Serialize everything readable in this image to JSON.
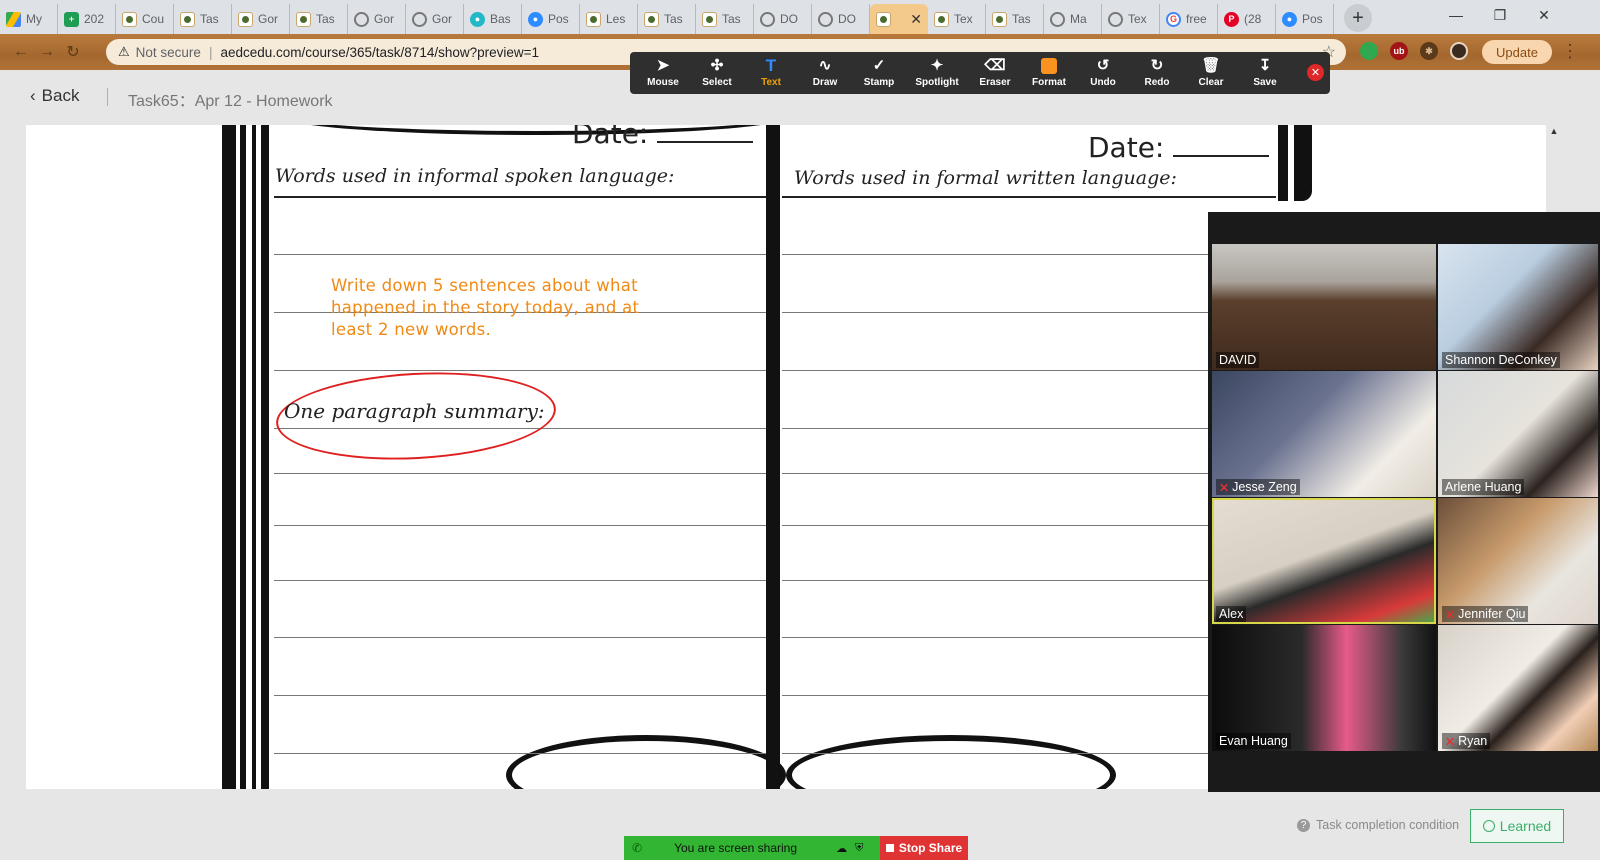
{
  "browser": {
    "tabs": [
      {
        "label": "My",
        "icon": "drive-icon"
      },
      {
        "label": "202",
        "icon": "sheets-icon"
      },
      {
        "label": "Cou",
        "icon": "doc-icon"
      },
      {
        "label": "Tas",
        "icon": "doc-icon"
      },
      {
        "label": "Gor",
        "icon": "doc-icon"
      },
      {
        "label": "Tas",
        "icon": "doc-icon"
      },
      {
        "label": "Gor",
        "icon": "globe-icon"
      },
      {
        "label": "Gor",
        "icon": "globe-icon"
      },
      {
        "label": "Bas",
        "icon": "teal-icon"
      },
      {
        "label": "Pos",
        "icon": "zoom-icon"
      },
      {
        "label": "Les",
        "icon": "doc-icon"
      },
      {
        "label": "Tas",
        "icon": "doc-icon"
      },
      {
        "label": "Tas",
        "icon": "doc-icon"
      },
      {
        "label": "DO",
        "icon": "globe-icon"
      },
      {
        "label": "DO",
        "icon": "globe-icon"
      },
      {
        "label": "",
        "icon": "doc-icon",
        "active": true
      },
      {
        "label": "Tex",
        "icon": "doc-icon"
      },
      {
        "label": "Tas",
        "icon": "doc-icon"
      },
      {
        "label": "Ma",
        "icon": "globe-icon"
      },
      {
        "label": "Tex",
        "icon": "globe-icon"
      },
      {
        "label": "free",
        "icon": "google-icon"
      },
      {
        "label": "(28",
        "icon": "pinterest-icon"
      },
      {
        "label": "Pos",
        "icon": "zoom-icon"
      }
    ],
    "security_label": "Not secure",
    "url": "aedcedu.com/course/365/task/8714/show?preview=1",
    "update_label": "Update",
    "colors": {
      "theme_wood": "#a4682f",
      "active_tab": "#f4ca8c"
    }
  },
  "page": {
    "back_label": "Back",
    "task_title": "Task65：Apr 12 - Homework",
    "completion_label": "Task completion condition",
    "learned_label": "Learned"
  },
  "annotation_toolbar": {
    "tools": [
      {
        "label": "Mouse",
        "icon": "pointer-icon"
      },
      {
        "label": "Select",
        "icon": "move-icon"
      },
      {
        "label": "Text",
        "icon": "text-icon",
        "active": true
      },
      {
        "label": "Draw",
        "icon": "draw-icon"
      },
      {
        "label": "Stamp",
        "icon": "stamp-icon"
      },
      {
        "label": "Spotlight",
        "icon": "spotlight-icon"
      },
      {
        "label": "Eraser",
        "icon": "eraser-icon"
      },
      {
        "label": "Format",
        "icon": "format-swatch-icon"
      },
      {
        "label": "Undo",
        "icon": "undo-icon"
      },
      {
        "label": "Redo",
        "icon": "redo-icon"
      },
      {
        "label": "Clear",
        "icon": "trash-icon"
      },
      {
        "label": "Save",
        "icon": "save-icon"
      }
    ],
    "format_color": "#f7931e"
  },
  "worksheet": {
    "left_date_label": "Date:",
    "right_date_label": "Date:",
    "left_heading": "Words used in informal spoken language:",
    "right_heading": "Words used in formal written language:",
    "instruction": "Write down 5 sentences about what happened in the story today, and at least 2 new words.",
    "summary_label": "One paragraph summary:",
    "instruction_color": "#f08a14",
    "ellipse_color": "#e02020"
  },
  "gallery": {
    "participants": [
      {
        "name": "DAVID",
        "muted": false,
        "active": false,
        "bg": "linear-gradient(180deg,#c8c6c2 0%,#a9a39b 30%,#5a3f2c 45%,#3f2a1c 100%)"
      },
      {
        "name": "Shannon DeConkey",
        "muted": false,
        "active": false,
        "bg": "linear-gradient(135deg,#d9e4ef 0%,#b9cde0 40%,#3a2a24 70%,#e8d3c2 100%)"
      },
      {
        "name": "Jesse Zeng",
        "muted": true,
        "active": false,
        "bg": "linear-gradient(135deg,#3b4660 0%,#6a7290 40%,#f1ede6 75%,#d9d2c6 100%)"
      },
      {
        "name": "Arlene Huang",
        "muted": false,
        "active": false,
        "bg": "linear-gradient(135deg,#d6dadb 0%,#e7e3dc 50%,#2c2420 75%,#f0d8cf 100%)"
      },
      {
        "name": "Alex",
        "muted": false,
        "active": true,
        "bg": "linear-gradient(160deg,#e5ddd2 0%,#d7cfc3 45%,#2a2a2a 60%,#d83a3a 85%,#3fae4a 100%)"
      },
      {
        "name": "Jennifer Qiu",
        "muted": true,
        "active": false,
        "bg": "linear-gradient(135deg,#6b4f3a 0%,#c79a6b 40%,#e9e5df 70%,#ddd5cc 100%)"
      },
      {
        "name": "Evan Huang",
        "muted": false,
        "active": false,
        "bg": "linear-gradient(90deg,#0c0c0c 0%,#2a2a2a 40%,#e75b8a 60%,#3a3a3a 85%,#111 100%)"
      },
      {
        "name": "Ryan",
        "muted": true,
        "active": false,
        "bg": "linear-gradient(135deg,#d7d1c8 0%,#f1ece6 45%,#2a211c 60%,#f0cdb5 80%,#b58a5a 100%)"
      }
    ],
    "active_outline": "#d7d74a"
  },
  "screen_share": {
    "status_label": "You are screen sharing",
    "stop_label": "Stop Share",
    "status_color": "#32b532",
    "stop_color": "#e03434"
  }
}
